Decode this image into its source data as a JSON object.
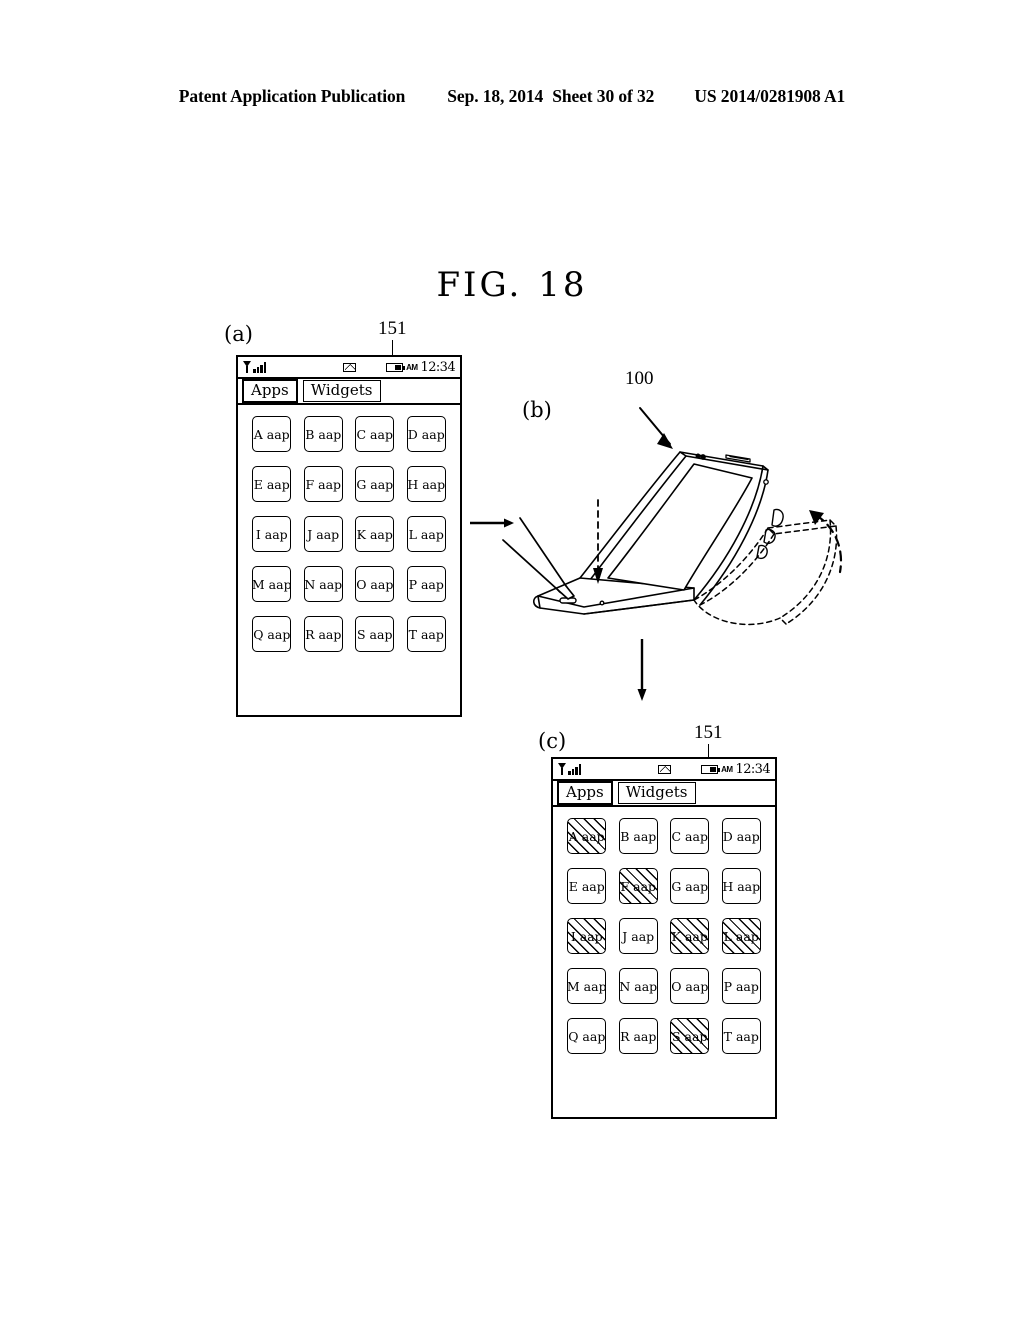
{
  "header": {
    "title": "Patent Application Publication",
    "date": "Sep. 18, 2014",
    "sheet": "Sheet 30 of 32",
    "patent_number": "US 2014/0281908 A1"
  },
  "figure": {
    "label": "FIG.",
    "number": "18"
  },
  "panels": {
    "a": {
      "label": "(a)",
      "ref_numeral": "151",
      "statusbar": {
        "signal_icon": "signal-bars-icon",
        "message_icon": "envelope-icon",
        "battery_icon": "battery-icon",
        "ampm": "AM",
        "time": "12:34"
      },
      "tabs": [
        {
          "label": "Apps",
          "selected": true
        },
        {
          "label": "Widgets",
          "selected": false
        }
      ],
      "apps": [
        {
          "label": "A aap",
          "hatched": false
        },
        {
          "label": "B aap",
          "hatched": false
        },
        {
          "label": "C aap",
          "hatched": false
        },
        {
          "label": "D aap",
          "hatched": false
        },
        {
          "label": "E aap",
          "hatched": false
        },
        {
          "label": "F aap",
          "hatched": false
        },
        {
          "label": "G aap",
          "hatched": false
        },
        {
          "label": "H aap",
          "hatched": false
        },
        {
          "label": "I aap",
          "hatched": false
        },
        {
          "label": "J aap",
          "hatched": false
        },
        {
          "label": "K aap",
          "hatched": false
        },
        {
          "label": "L aap",
          "hatched": false
        },
        {
          "label": "M aap",
          "hatched": false
        },
        {
          "label": "N aap",
          "hatched": false
        },
        {
          "label": "O aap",
          "hatched": false
        },
        {
          "label": "P aap",
          "hatched": false
        },
        {
          "label": "Q aap",
          "hatched": false
        },
        {
          "label": "R aap",
          "hatched": false
        },
        {
          "label": "S aap",
          "hatched": false
        },
        {
          "label": "T aap",
          "hatched": false
        }
      ]
    },
    "b": {
      "label": "(b)",
      "ref_numeral": "100",
      "description": "bent-flexible-phone-illustration"
    },
    "c": {
      "label": "(c)",
      "ref_numeral": "151",
      "statusbar": {
        "signal_icon": "signal-bars-icon",
        "message_icon": "envelope-icon",
        "battery_icon": "battery-icon",
        "ampm": "AM",
        "time": "12:34"
      },
      "tabs": [
        {
          "label": "Apps",
          "selected": true
        },
        {
          "label": "Widgets",
          "selected": false
        }
      ],
      "apps": [
        {
          "label": "A aap",
          "hatched": true
        },
        {
          "label": "B aap",
          "hatched": false
        },
        {
          "label": "C aap",
          "hatched": false
        },
        {
          "label": "D aap",
          "hatched": false
        },
        {
          "label": "E aap",
          "hatched": false
        },
        {
          "label": "F aap",
          "hatched": true
        },
        {
          "label": "G aap",
          "hatched": false
        },
        {
          "label": "H aap",
          "hatched": false
        },
        {
          "label": "I aap",
          "hatched": true
        },
        {
          "label": "J aap",
          "hatched": false
        },
        {
          "label": "K aap",
          "hatched": true
        },
        {
          "label": "L aap",
          "hatched": true
        },
        {
          "label": "M aap",
          "hatched": false
        },
        {
          "label": "N aap",
          "hatched": false
        },
        {
          "label": "O aap",
          "hatched": false
        },
        {
          "label": "P aap",
          "hatched": false
        },
        {
          "label": "Q aap",
          "hatched": false
        },
        {
          "label": "R aap",
          "hatched": false
        },
        {
          "label": "S aap",
          "hatched": true
        },
        {
          "label": "T aap",
          "hatched": false
        }
      ]
    }
  },
  "arrows": {
    "a_to_b": "right-arrow",
    "b_to_c": "down-arrow"
  },
  "colors": {
    "ink": "#000000",
    "paper": "#ffffff"
  }
}
